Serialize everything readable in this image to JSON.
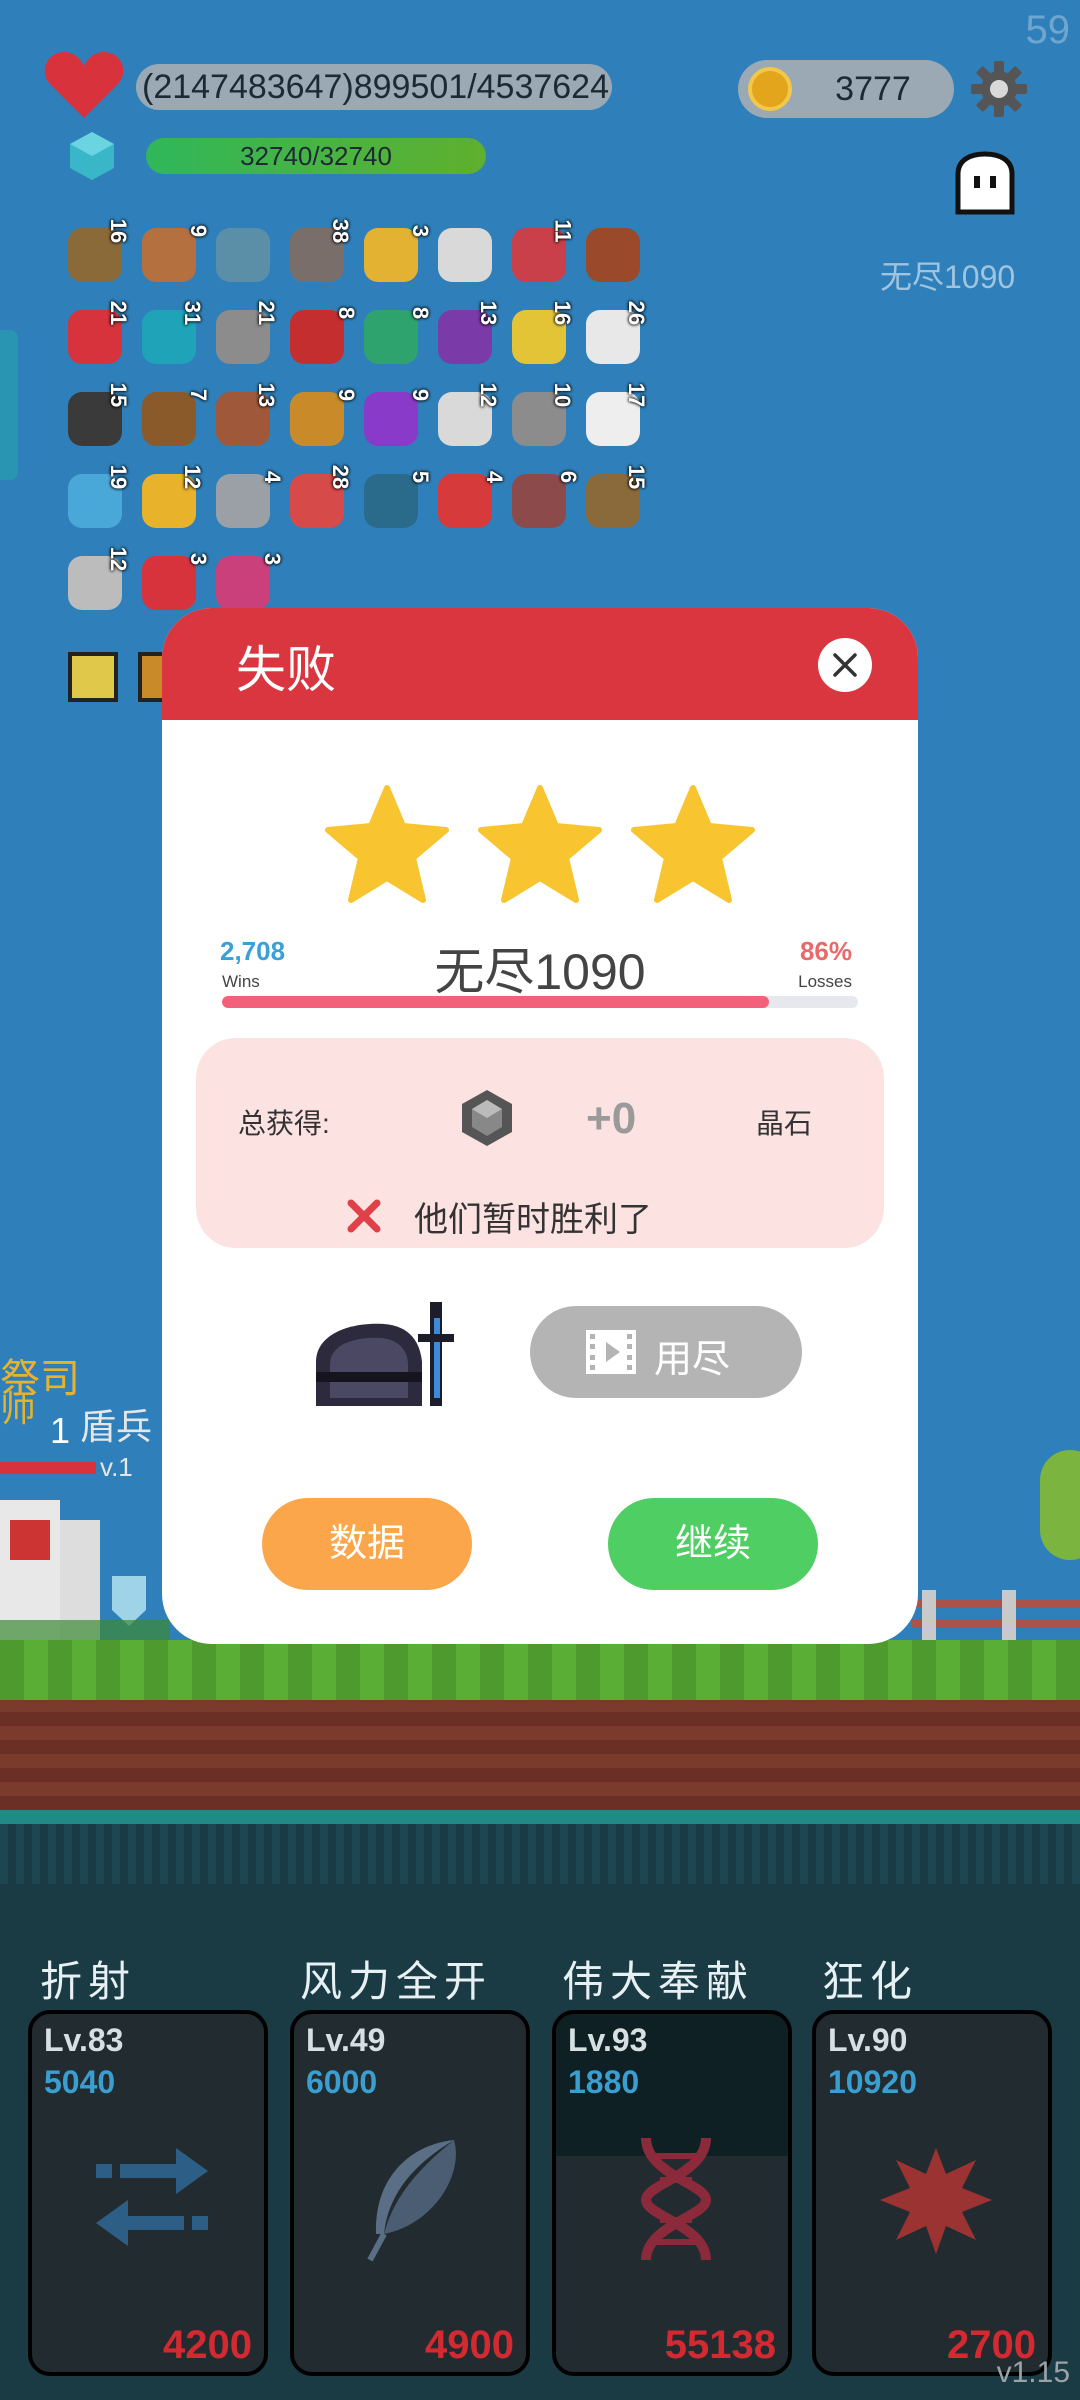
{
  "hud": {
    "fps": "59",
    "hp_text": "(2147483647)899501/4537624",
    "shield_text": "32740/32740",
    "coins": "3777",
    "stage": "无尽1090"
  },
  "items": [
    {
      "icon": "dagger-icon",
      "count": "16",
      "color": "#8b6a3a"
    },
    {
      "icon": "shield-round-icon",
      "count": "9",
      "color": "#b5703f"
    },
    {
      "icon": "magnifier-icon",
      "count": "",
      "color": "#5b8fa8"
    },
    {
      "icon": "rock-icon",
      "count": "38",
      "color": "#7a6e6a"
    },
    {
      "icon": "ring-icon",
      "count": "3",
      "color": "#e4b233"
    },
    {
      "icon": "glove-icon",
      "count": "",
      "color": "#d9d9d9"
    },
    {
      "icon": "badge-icon",
      "count": "11",
      "color": "#c9404a"
    },
    {
      "icon": "chest-icon",
      "count": "",
      "color": "#9a4a2a"
    },
    {
      "icon": "strawberry-icon",
      "count": "21",
      "color": "#d6333d"
    },
    {
      "icon": "hex-crystal-icon",
      "count": "31",
      "color": "#1fa3b8"
    },
    {
      "icon": "mace-icon",
      "count": "21",
      "color": "#8c8c8c"
    },
    {
      "icon": "apple-icon",
      "count": "8",
      "color": "#c42e2e"
    },
    {
      "icon": "plant-icon",
      "count": "8",
      "color": "#2fa36d"
    },
    {
      "icon": "hat-icon",
      "count": "13",
      "color": "#7a3aa8"
    },
    {
      "icon": "wand-icon",
      "count": "16",
      "color": "#e4c437"
    },
    {
      "icon": "dice-icon",
      "count": "26",
      "color": "#e8e8e8"
    },
    {
      "icon": "pot-icon",
      "count": "15",
      "color": "#3a3a3a"
    },
    {
      "icon": "meteor-icon",
      "count": "7",
      "color": "#8a5a2a"
    },
    {
      "icon": "cake-icon",
      "count": "13",
      "color": "#a0583a"
    },
    {
      "icon": "book-icon",
      "count": "9",
      "color": "#c98a2a"
    },
    {
      "icon": "orb-icon",
      "count": "9",
      "color": "#8a3ac9"
    },
    {
      "icon": "bulb-icon",
      "count": "12",
      "color": "#d9d9d9"
    },
    {
      "icon": "axe-icon",
      "count": "10",
      "color": "#8c8c8c"
    },
    {
      "icon": "ghost-item-icon",
      "count": "17",
      "color": "#eeeeee"
    },
    {
      "icon": "potion-icon",
      "count": "19",
      "color": "#4aa8d8"
    },
    {
      "icon": "sunflower-icon",
      "count": "12",
      "color": "#e8b32a"
    },
    {
      "icon": "hook-icon",
      "count": "4",
      "color": "#9aa0a6"
    },
    {
      "icon": "pill-icon",
      "count": "28",
      "color": "#d64a4a"
    },
    {
      "icon": "fish-icon",
      "count": "5",
      "color": "#2a6a8a"
    },
    {
      "icon": "hearts-icon",
      "count": "4",
      "color": "#d63a3a"
    },
    {
      "icon": "tombstone-icon",
      "count": "6",
      "color": "#8c4a4a"
    },
    {
      "icon": "crossbow-icon",
      "count": "15",
      "color": "#8a6a3a"
    },
    {
      "icon": "letter-icon",
      "count": "12",
      "color": "#bcbcbc"
    },
    {
      "icon": "watermelon-icon",
      "count": "3",
      "color": "#d6333d"
    },
    {
      "icon": "jar-icon",
      "count": "3",
      "color": "#c9407a"
    }
  ],
  "battlefield": {
    "label_priest": "祭司",
    "label_a": "师",
    "label_b": "盾兵",
    "label_c": "1",
    "label_d": "v.1"
  },
  "modal": {
    "title": "失败",
    "stars": 3,
    "wins_count": "2,708",
    "wins_label": "Wins",
    "stage_name": "无尽1090",
    "loss_pct": "86%",
    "loss_label": "Losses",
    "progress": 0.86,
    "total_label": "总获得:",
    "gain": "+0",
    "crystal_label": "晶石",
    "result_message": "他们暂时胜利了",
    "ad_label": "用尽",
    "data_button": "数据",
    "continue_button": "继续"
  },
  "skills": [
    {
      "name": "折射",
      "level": "Lv.83",
      "cost": "5040",
      "price": "4200",
      "icon": "swap-arrows-icon"
    },
    {
      "name": "风力全开",
      "level": "Lv.49",
      "cost": "6000",
      "price": "4900",
      "icon": "feather-icon"
    },
    {
      "name": "伟大奉献",
      "level": "Lv.93",
      "cost": "1880",
      "price": "55138",
      "icon": "dna-icon"
    },
    {
      "name": "狂化",
      "level": "Lv.90",
      "cost": "10920",
      "price": "2700",
      "icon": "splat-icon"
    }
  ],
  "version": "v1.15",
  "colors": {
    "header_red": "#d9363f",
    "wins_blue": "#3aa0d8",
    "loss_red": "#e86a6a",
    "data_orange": "#fba64a",
    "continue_green": "#4fcf63",
    "star_yellow": "#f8c531",
    "price_red": "#d32a32"
  }
}
